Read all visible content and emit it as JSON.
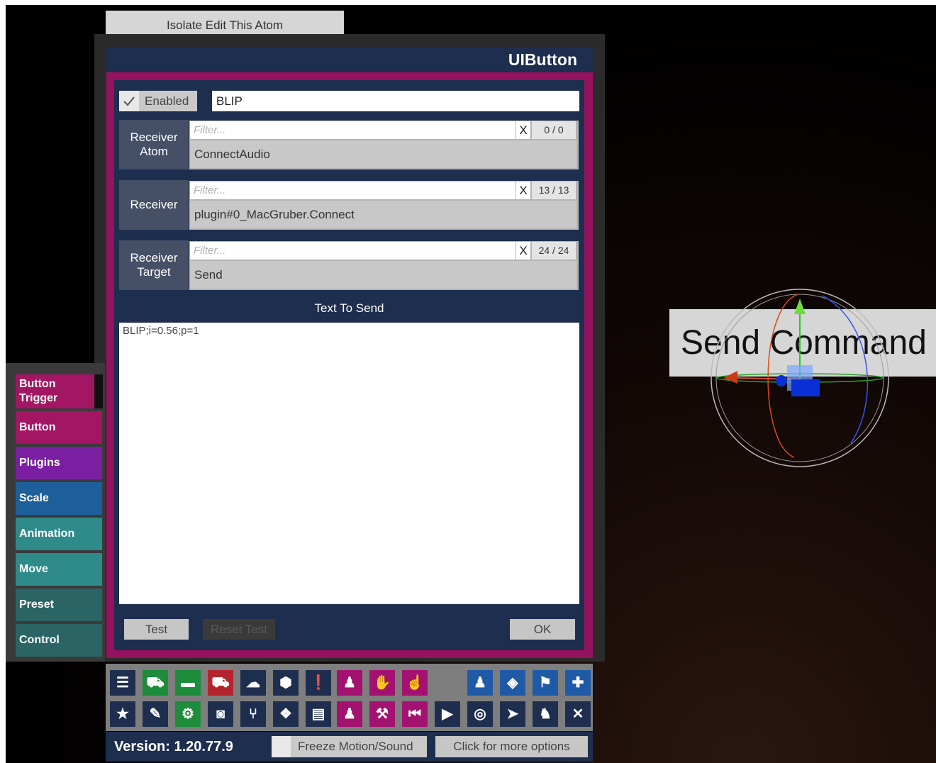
{
  "isolate_button_label": "Isolate Edit This Atom",
  "panel": {
    "title": "UIButton",
    "enabled_label": "Enabled",
    "name_value": "BLIP",
    "receiver_atom": {
      "label_line1": "Receiver",
      "label_line2": "Atom",
      "filter_placeholder": "Filter...",
      "clear": "X",
      "count": "0 / 0",
      "value": "ConnectAudio"
    },
    "receiver": {
      "label": "Receiver",
      "filter_placeholder": "Filter...",
      "clear": "X",
      "count": "13 / 13",
      "value": "plugin#0_MacGruber.Connect"
    },
    "receiver_target": {
      "label_line1": "Receiver",
      "label_line2": "Target",
      "filter_placeholder": "Filter...",
      "clear": "X",
      "count": "24 / 24",
      "value": "Send"
    },
    "text_to_send_label": "Text To Send",
    "text_to_send_value": "BLIP;i=0.56;p=1",
    "test_label": "Test",
    "reset_test_label": "Reset Test",
    "ok_label": "OK"
  },
  "tabs": [
    {
      "line1": "Button",
      "line2": "Trigger",
      "color": "#a31663"
    },
    {
      "line1": "Button",
      "line2": "",
      "color": "#a31663"
    },
    {
      "line1": "Plugins",
      "line2": "",
      "color": "#7b1fa2"
    },
    {
      "line1": "Scale",
      "line2": "",
      "color": "#1d5f9b"
    },
    {
      "line1": "Animation",
      "line2": "",
      "color": "#2f8a8a"
    },
    {
      "line1": "Move",
      "line2": "",
      "color": "#2f8a8a"
    },
    {
      "line1": "Preset",
      "line2": "",
      "color": "#2a6464"
    },
    {
      "line1": "Control",
      "line2": "",
      "color": "#2a6464"
    }
  ],
  "toolbar": {
    "row1": [
      "menu-icon",
      "save-scene-icon",
      "open-folder-icon",
      "load-scene-icon",
      "cloud-download-icon",
      "package-icon",
      "alert-icon",
      "add-person-icon",
      "hand-icon",
      "pointer-hand-icon",
      "person-icon",
      "unity-icon",
      "flag-icon",
      "plus-icon"
    ],
    "row2": [
      "star-icon",
      "edit-save-icon",
      "settings-folder-icon",
      "camera-icon",
      "split-icon",
      "dropbox-icon",
      "document-icon",
      "remove-person-icon",
      "tool-icon",
      "skip-back-icon",
      "play-icon",
      "target-icon",
      "cursor-icon",
      "people-icon",
      "close-tools-icon"
    ]
  },
  "status": {
    "version": "Version: 1.20.77.9",
    "freeze_label": "Freeze Motion/Sound",
    "more_options": "Click for more options"
  },
  "scene": {
    "label": "Send Command"
  }
}
